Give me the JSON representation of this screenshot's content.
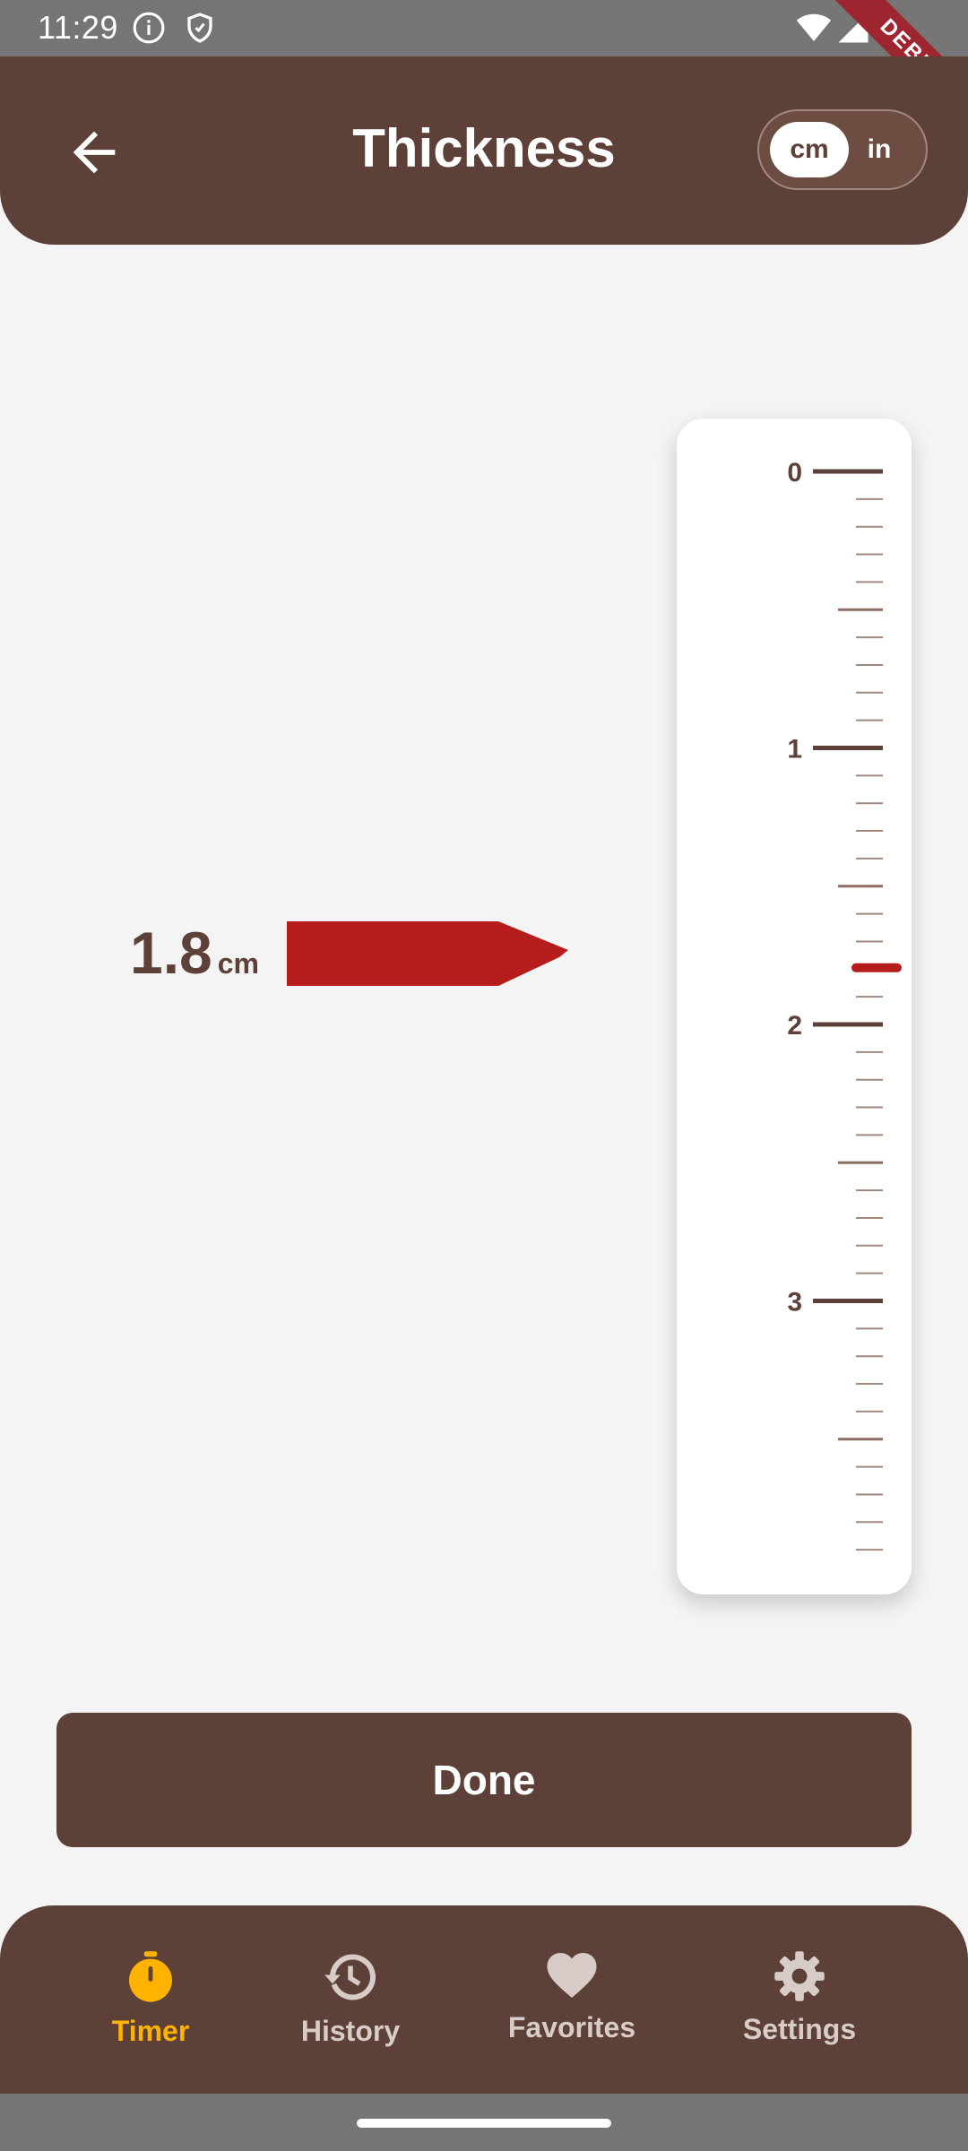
{
  "status_bar": {
    "time": "11:29",
    "debug_label": "DEBUG"
  },
  "app_bar": {
    "title": "Thickness",
    "back_icon": "arrow-left-icon",
    "unit_toggle": {
      "options": [
        "cm",
        "in"
      ],
      "selected": "cm"
    }
  },
  "ruler": {
    "labels": [
      "0",
      "1",
      "2",
      "3"
    ],
    "max_cm": 3.9,
    "minor_step_cm": 0.1,
    "indicator_value_cm": 1.8
  },
  "readout": {
    "value": "1.8",
    "unit": "cm"
  },
  "done_button": {
    "label": "Done"
  },
  "bottom_nav": {
    "items": [
      {
        "label": "Timer",
        "icon": "stopwatch-icon",
        "active": true
      },
      {
        "label": "History",
        "icon": "history-icon",
        "active": false
      },
      {
        "label": "Favorites",
        "icon": "heart-icon",
        "active": false
      },
      {
        "label": "Settings",
        "icon": "gear-icon",
        "active": false
      }
    ]
  },
  "colors": {
    "brand": "#5d4037",
    "accent": "#ffb300",
    "indicator": "#b71c1c",
    "background": "#f4f4f4"
  }
}
